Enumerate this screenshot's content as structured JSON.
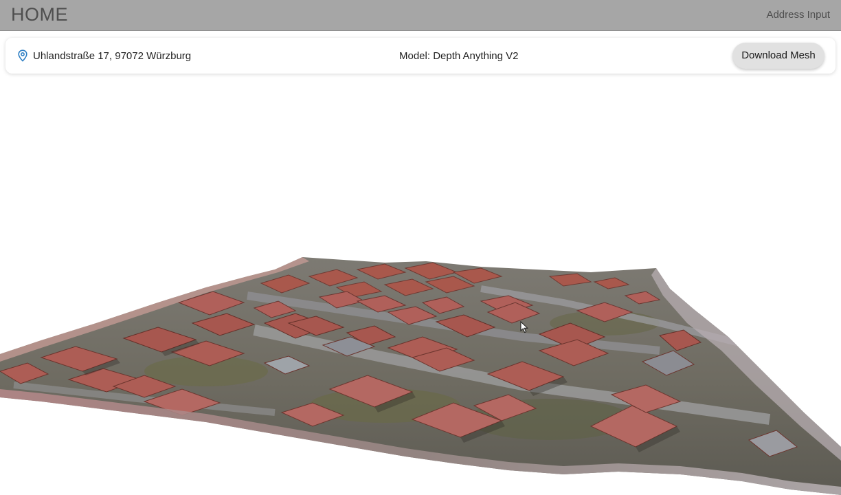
{
  "header": {
    "title": "HOME",
    "address_input_link": "Address Input"
  },
  "info_bar": {
    "address": "Uhlandstraße 17, 97072 Würzburg",
    "model_label": "Model: Depth Anything V2",
    "download_button": "Download Mesh"
  },
  "icons": {
    "location": "location-pin-icon",
    "cursor": "mouse-cursor-icon"
  },
  "colors": {
    "header_bg": "#a6a6a6",
    "button_bg": "#e1e1e1",
    "pin_blue": "#2e7fc4",
    "roof_red": "#a9584c"
  }
}
